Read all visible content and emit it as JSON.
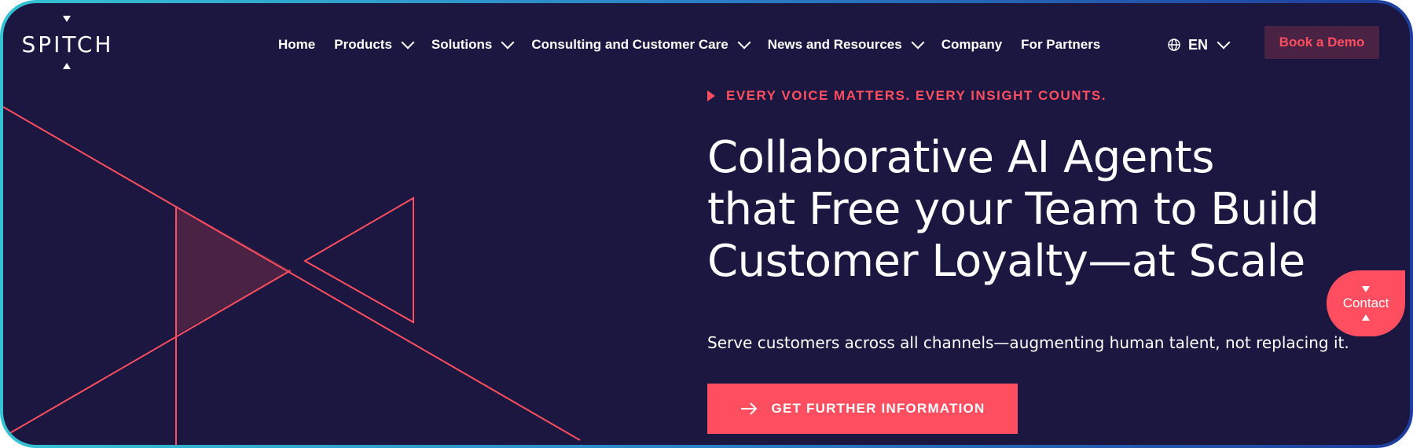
{
  "brand": {
    "name": "SPITCH"
  },
  "nav": {
    "items": [
      {
        "label": "Home",
        "has_dropdown": false
      },
      {
        "label": "Products",
        "has_dropdown": true
      },
      {
        "label": "Solutions",
        "has_dropdown": true
      },
      {
        "label": "Consulting and Customer Care",
        "has_dropdown": true
      },
      {
        "label": "News and Resources",
        "has_dropdown": true
      },
      {
        "label": "Company",
        "has_dropdown": false
      },
      {
        "label": "For Partners",
        "has_dropdown": false
      }
    ],
    "language": "EN",
    "demo_button": "Book a Demo"
  },
  "hero": {
    "kicker": "EVERY VOICE MATTERS. EVERY INSIGHT COUNTS.",
    "headline_lines": [
      "Collaborative AI Agents",
      "that Free your Team to Build",
      "Customer Loyalty—at Scale"
    ],
    "subline": "Serve customers across all channels—augmenting human talent, not replacing it.",
    "cta": "GET FURTHER INFORMATION"
  },
  "contact": {
    "label": "Contact"
  },
  "colors": {
    "background": "#1b1740",
    "accent": "#ff4e5f",
    "text": "#ffffff",
    "demo_bg": "#4a2244",
    "frame_gradient": [
      "#35c3d3",
      "#1e3d9c"
    ]
  },
  "icons": {
    "logo_markers": "triangle",
    "nav_dropdown": "chevron-down-icon",
    "language": "globe-icon",
    "kicker": "play-icon",
    "cta": "arrow-right-icon"
  }
}
